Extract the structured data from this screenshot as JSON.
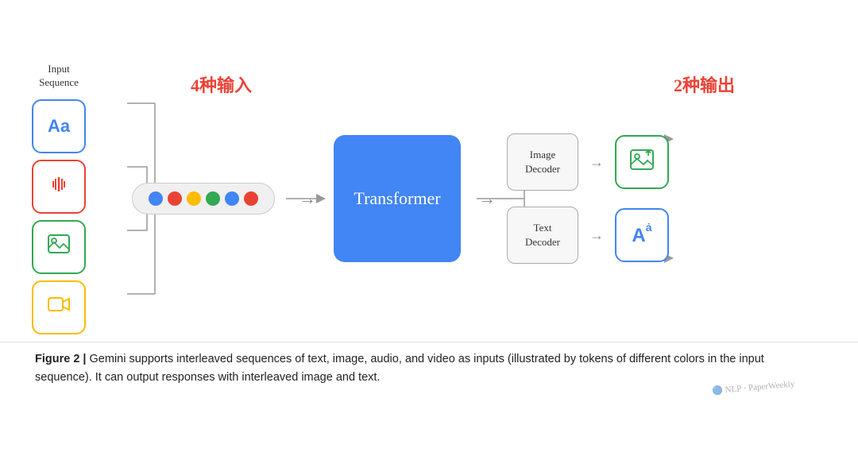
{
  "diagram": {
    "input_label": "Input\nSequence",
    "label_inputs": "4种输入",
    "label_outputs": "2种输出",
    "transformer_label": "Transformer",
    "image_decoder_label": "Image\nDecoder",
    "text_decoder_label": "Text\nDecoder",
    "token_colors": [
      "#4285f4",
      "#ea4335",
      "#fbbc04",
      "#34a853",
      "#4285f4",
      "#ea4335"
    ],
    "input_boxes": [
      {
        "symbol": "Aa",
        "color_class": "blue",
        "aria": "text-input"
      },
      {
        "symbol": "audio",
        "color_class": "red",
        "aria": "audio-input"
      },
      {
        "symbol": "image",
        "color_class": "green",
        "aria": "image-input"
      },
      {
        "symbol": "video",
        "color_class": "yellow",
        "aria": "video-input"
      }
    ],
    "output_boxes": [
      {
        "label": "Image\nDecoder",
        "icon": "🖼",
        "color_class": "green"
      },
      {
        "label": "Text\nDecoder",
        "icon": "Aȧ",
        "color_class": "blue"
      }
    ]
  },
  "caption": {
    "bold_part": "Figure 2 |",
    "text": " Gemini supports interleaved sequences of text, image, audio, and video as inputs (illustrated by tokens of different colors in the input sequence). It can output responses with interleaved image and text."
  },
  "watermark": "NLP · PaperWeekly"
}
